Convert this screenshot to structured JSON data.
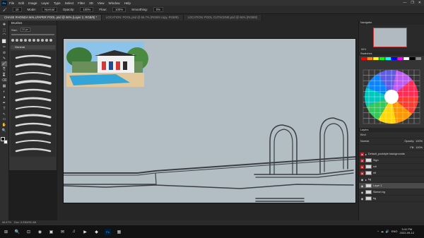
{
  "app": {
    "logo": "Ps",
    "menu": [
      "File",
      "Edit",
      "Image",
      "Layer",
      "Type",
      "Select",
      "Filter",
      "3D",
      "View",
      "Window",
      "Help"
    ],
    "window_controls": [
      "—",
      "❐",
      "✕"
    ]
  },
  "options": {
    "size": "10",
    "mode_label": "Mode:",
    "mode": "Normal",
    "opacity_label": "Opacity:",
    "opacity": "100%",
    "flow_label": "Flow:",
    "flow": "100%",
    "smoothing_label": "Smoothing:",
    "smoothing": "0%"
  },
  "tabs": [
    {
      "label": "CHASE RHONDA WALLPAPER POOL.psd @ 66% (Layer 2, RGB/8) *",
      "active": true
    },
    {
      "label": "LOCATION: POOL.psd @ 66.7% (RGB/8 copy, RGB/8)",
      "active": false
    },
    {
      "label": "LOCATION: POOL CUTSCENE.psd @ 66% (RGB/8)",
      "active": false
    }
  ],
  "tools": [
    "✥",
    "⬚",
    "⌒",
    "⬜",
    "✂",
    "⊘",
    "✎",
    "🖌",
    "⎘",
    "⌛",
    "⌫",
    "▦",
    "◐",
    "●",
    "✒",
    "T",
    "↖",
    "▭",
    "✋",
    "🔍"
  ],
  "brushes": {
    "title": "Brushes",
    "size_label": "Size:",
    "size_value": "10 px",
    "folder": "General"
  },
  "navigator": {
    "title": "Navigator",
    "zoom": "66%"
  },
  "swatches": {
    "title": "Swatches",
    "wheel": [
      "#ff3b30",
      "#ff9500",
      "#ffd60a",
      "#34c759",
      "#00c7be",
      "#0a84ff",
      "#5e5ce6",
      "#bf5af2",
      "#ff2d55"
    ]
  },
  "layers": {
    "title": "Layers",
    "kind_label": "Kind",
    "mode": "Normal",
    "opacity_label": "Opacity:",
    "opacity": "100%",
    "fill_label": "Fill:",
    "fill": "100%",
    "rows": [
      {
        "name": "Default_poolstyle backgrounds",
        "eye": "red",
        "selected": false
      },
      {
        "name": "Sign",
        "eye": "red",
        "selected": false
      },
      {
        "name": "roll",
        "eye": "red",
        "selected": false
      },
      {
        "name": "rlif",
        "eye": "red",
        "selected": false
      },
      {
        "name": "bg",
        "eye": "plain",
        "selected": false
      },
      {
        "name": "Layer 1",
        "eye": "plain",
        "selected": true
      },
      {
        "name": "Sketch bg",
        "eye": "plain",
        "selected": false
      },
      {
        "name": "bg",
        "eye": "plain",
        "selected": false
      }
    ]
  },
  "status": {
    "zoom": "66.67%",
    "doc": "Doc: 5.93M/92.4M"
  },
  "taskbar": {
    "apps": [
      "⊞",
      "🔍",
      "⊡",
      "◉",
      "▣",
      "✉",
      "♫",
      "▶",
      "◆",
      "Ps",
      "▦"
    ],
    "tray": [
      "^",
      "☁",
      "🔊",
      "ENG"
    ],
    "time": "3:41 PM",
    "date": "2022-09-12"
  }
}
